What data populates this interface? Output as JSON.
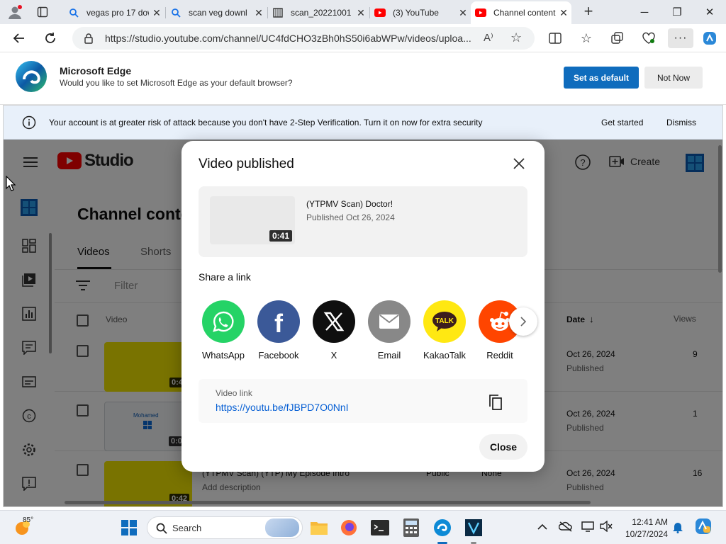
{
  "browser": {
    "tabs": [
      {
        "title": "vegas pro 17 dow",
        "icon": "search-icon"
      },
      {
        "title": "scan veg downl",
        "icon": "search-icon"
      },
      {
        "title": "scan_20221001",
        "icon": "document-icon"
      },
      {
        "title": "(3) YouTube",
        "icon": "youtube-icon"
      },
      {
        "title": "Channel content",
        "icon": "youtube-studio-icon"
      }
    ],
    "url": "https://studio.youtube.com/channel/UC4fdCHO3zBh0hS50i6abWPw/videos/uploa...",
    "new_tab": "+"
  },
  "edge_prompt": {
    "title": "Microsoft Edge",
    "message": "Would you like to set Microsoft Edge as your default browser?",
    "primary": "Set as default",
    "secondary": "Not Now"
  },
  "security_banner": {
    "text": "Your account is at greater risk of attack because you don't have 2-Step Verification. Turn it on now for extra security",
    "get_started": "Get started",
    "dismiss": "Dismiss"
  },
  "studio": {
    "logo": "Studio",
    "create": "Create",
    "page_title": "Channel conte",
    "tabs": [
      "Videos",
      "Shorts"
    ],
    "filter": "Filter",
    "columns": {
      "video": "Video",
      "date": "Date",
      "views": "Views"
    },
    "rows": [
      {
        "duration": "0:42",
        "date": "Oct 26, 2024",
        "status": "Published",
        "views": "9"
      },
      {
        "duration": "0:03",
        "date": "Oct 26, 2024",
        "status": "Published",
        "views": "1",
        "thumb_text": "Mohamed"
      },
      {
        "duration": "0:42",
        "date": "Oct 26, 2024",
        "status": "Published",
        "views": "16",
        "title": "(YTPMV Scan) (YTP) My Episode Intro",
        "desc": "Add description",
        "visibility": "Public",
        "restrictions": "None"
      }
    ]
  },
  "dialog": {
    "title": "Video published",
    "video_title": "(YTPMV Scan) Doctor!",
    "published": "Published Oct 26, 2024",
    "duration": "0:41",
    "share_label": "Share a link",
    "share_targets": [
      {
        "name": "WhatsApp",
        "color": "#25d366"
      },
      {
        "name": "Facebook",
        "color": "#3b5998"
      },
      {
        "name": "X",
        "color": "#0f0f0f"
      },
      {
        "name": "Email",
        "color": "#888888"
      },
      {
        "name": "KakaoTalk",
        "color": "#ffe812"
      },
      {
        "name": "Reddit",
        "color": "#ff4500"
      }
    ],
    "video_link_label": "Video link",
    "video_link": "https://youtu.be/fJBPD7O0NnI",
    "close": "Close"
  },
  "taskbar": {
    "weather": "85°",
    "search": "Search",
    "time": "12:41 AM",
    "date": "10/27/2024"
  },
  "colors": {
    "accent": "#0f6cbd",
    "link": "#065fd4",
    "youtube_red": "#ff0000"
  }
}
